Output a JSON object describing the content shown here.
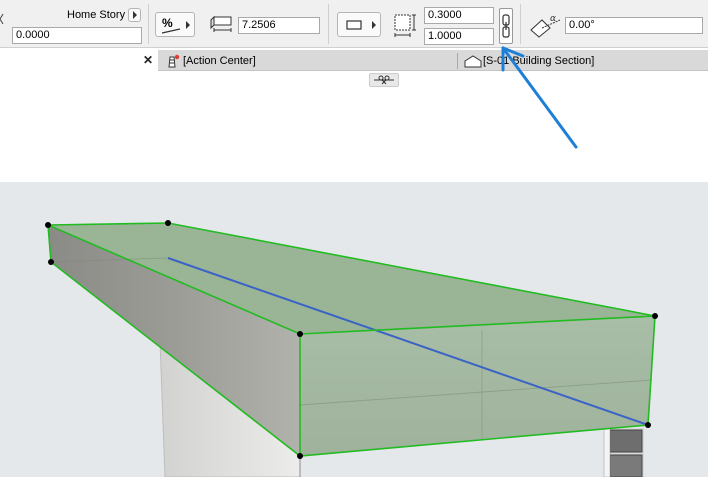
{
  "toolbar": {
    "home_story_label": "Home Story",
    "home_story_value": "0.0000",
    "percent_symbol": "%",
    "width_value": "7.2506",
    "thickness_value": "0.3000",
    "height_value": "1.0000",
    "angle_value": "0.00°"
  },
  "tabs": [
    {
      "label": "[Action Center]"
    },
    {
      "label": "[S-01 Building Section]"
    }
  ],
  "colors": {
    "slab_edge": "#22bb22",
    "slab_top": "#98b494",
    "reference_line": "#3b63c6",
    "annotation_arrow": "#1e7fd6"
  }
}
